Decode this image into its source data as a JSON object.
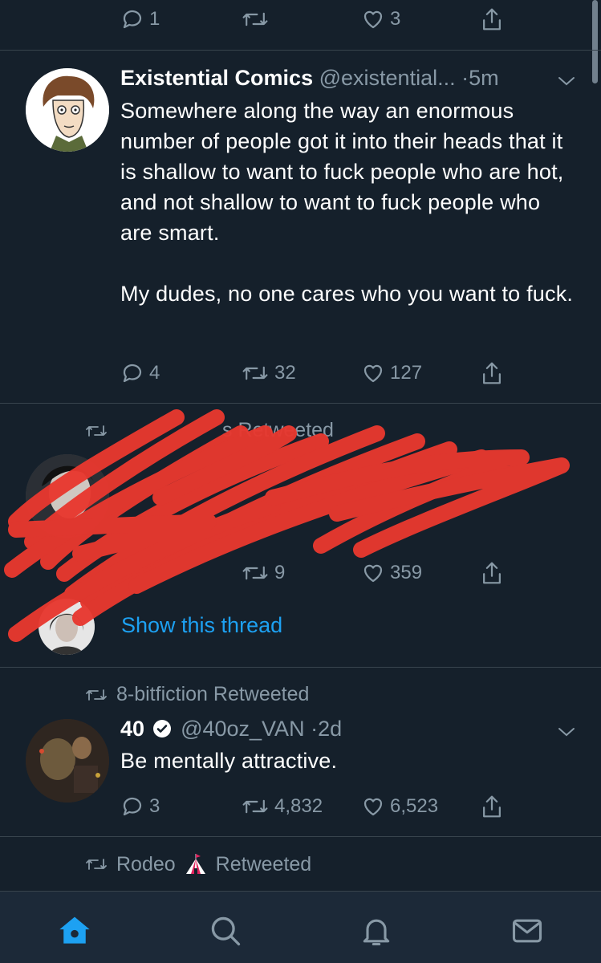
{
  "top_tweet_actions": {
    "reply_count": "1",
    "retweet_count": "",
    "like_count": "3"
  },
  "tweet1": {
    "name": "Existential Comics",
    "handle": "@existential...",
    "time": "·5m",
    "text": "Somewhere along the way an enormous number of people got it into their heads that it is shallow to want to fuck people who are hot, and not shallow to want to fuck people who are smart.\n\nMy dudes, no one cares who you want to fuck.",
    "reply_count": "4",
    "retweet_count": "32",
    "like_count": "127"
  },
  "tweet2": {
    "retweeted_by": "s Retweeted",
    "retweet_count": "9",
    "like_count": "359",
    "show_thread": "Show this thread",
    "redaction_color": "#e8382f"
  },
  "tweet3": {
    "retweeted_by": "8-bitfiction Retweeted",
    "name": "40",
    "handle": "@40oz_VAN",
    "time": "·2d",
    "text": "Be mentally attractive.",
    "reply_count": "3",
    "retweet_count": "4,832",
    "like_count": "6,523"
  },
  "tweet4": {
    "retweeted_by_name": "Rodeo",
    "retweeted_suffix": "Retweeted"
  },
  "tabbar": {
    "items": [
      "home-icon",
      "search-icon",
      "notifications-icon",
      "messages-icon"
    ],
    "active": "home-icon",
    "accent": "#1da1f2"
  }
}
